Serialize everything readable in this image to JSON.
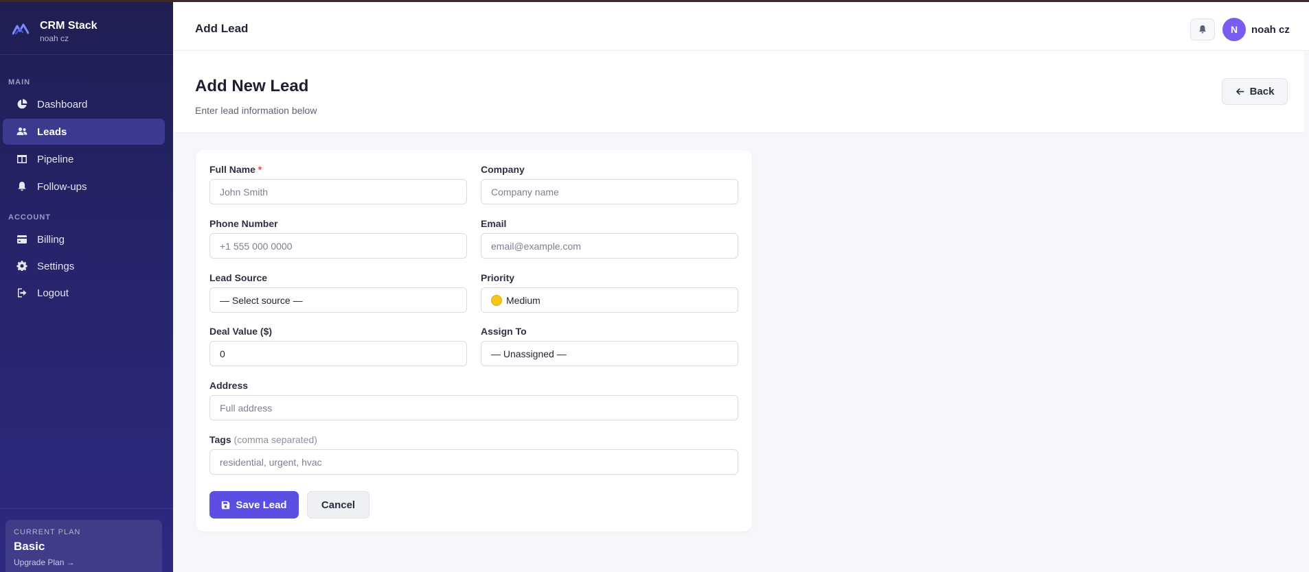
{
  "brand": {
    "name": "CRM Stack",
    "user": "noah cz",
    "logo_icon": "logo-mark-icon"
  },
  "sidebar": {
    "main_label": "MAIN",
    "account_label": "ACCOUNT",
    "items": [
      {
        "label": "Dashboard",
        "icon": "pie-chart-icon",
        "active": false
      },
      {
        "label": "Leads",
        "icon": "users-icon",
        "active": true
      },
      {
        "label": "Pipeline",
        "icon": "columns-icon",
        "active": false
      },
      {
        "label": "Follow-ups",
        "icon": "bell-icon",
        "active": false
      },
      {
        "label": "Billing",
        "icon": "credit-card-icon",
        "active": false
      },
      {
        "label": "Settings",
        "icon": "gear-icon",
        "active": false
      },
      {
        "label": "Logout",
        "icon": "logout-icon",
        "active": false
      }
    ],
    "plan": {
      "label": "CURRENT PLAN",
      "name": "Basic",
      "upgrade": "Upgrade Plan →"
    }
  },
  "header": {
    "title": "Add Lead",
    "avatar_initial": "N",
    "user_name": "noah cz"
  },
  "page": {
    "title": "Add New Lead",
    "subtitle": "Enter lead information below",
    "back_label": "Back"
  },
  "form": {
    "full_name": {
      "label": "Full Name",
      "required_mark": "*",
      "placeholder": "John Smith",
      "value": ""
    },
    "company": {
      "label": "Company",
      "placeholder": "Company name",
      "value": ""
    },
    "phone": {
      "label": "Phone Number",
      "placeholder": "+1 555 000 0000",
      "value": ""
    },
    "email": {
      "label": "Email",
      "placeholder": "email@example.com",
      "value": ""
    },
    "lead_source": {
      "label": "Lead Source",
      "value": "— Select source —"
    },
    "priority": {
      "label": "Priority",
      "value": "Medium",
      "color": "#f5c518"
    },
    "deal_value": {
      "label": "Deal Value ($)",
      "value": "0"
    },
    "assign_to": {
      "label": "Assign To",
      "value": "— Unassigned —"
    },
    "address": {
      "label": "Address",
      "placeholder": "Full address",
      "value": ""
    },
    "tags": {
      "label": "Tags",
      "hint": "(comma separated)",
      "placeholder": "residential, urgent, hvac",
      "value": ""
    },
    "save_label": "Save Lead",
    "cancel_label": "Cancel"
  },
  "colors": {
    "accent": "#5b4fe3",
    "sidebar_bg": "#23225e",
    "active_item": "#3b3a8f",
    "avatar": "#7b5cf0"
  }
}
